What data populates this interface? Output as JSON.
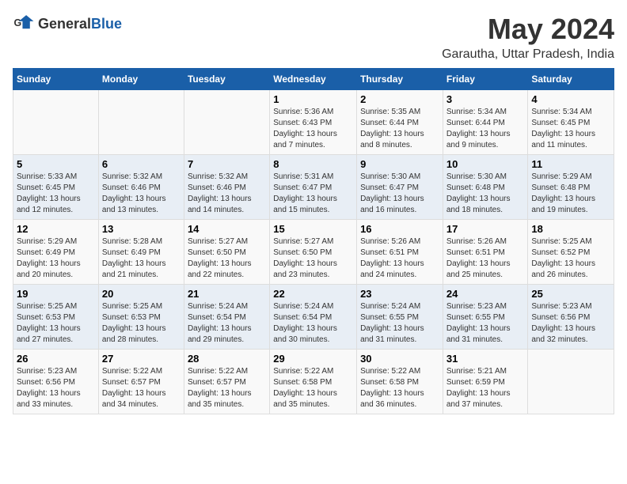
{
  "header": {
    "logo_general": "General",
    "logo_blue": "Blue",
    "title": "May 2024",
    "subtitle": "Garautha, Uttar Pradesh, India"
  },
  "columns": [
    "Sunday",
    "Monday",
    "Tuesday",
    "Wednesday",
    "Thursday",
    "Friday",
    "Saturday"
  ],
  "weeks": [
    {
      "days": [
        {
          "num": "",
          "info": ""
        },
        {
          "num": "",
          "info": ""
        },
        {
          "num": "",
          "info": ""
        },
        {
          "num": "1",
          "info": "Sunrise: 5:36 AM\nSunset: 6:43 PM\nDaylight: 13 hours\nand 7 minutes."
        },
        {
          "num": "2",
          "info": "Sunrise: 5:35 AM\nSunset: 6:44 PM\nDaylight: 13 hours\nand 8 minutes."
        },
        {
          "num": "3",
          "info": "Sunrise: 5:34 AM\nSunset: 6:44 PM\nDaylight: 13 hours\nand 9 minutes."
        },
        {
          "num": "4",
          "info": "Sunrise: 5:34 AM\nSunset: 6:45 PM\nDaylight: 13 hours\nand 11 minutes."
        }
      ]
    },
    {
      "days": [
        {
          "num": "5",
          "info": "Sunrise: 5:33 AM\nSunset: 6:45 PM\nDaylight: 13 hours\nand 12 minutes."
        },
        {
          "num": "6",
          "info": "Sunrise: 5:32 AM\nSunset: 6:46 PM\nDaylight: 13 hours\nand 13 minutes."
        },
        {
          "num": "7",
          "info": "Sunrise: 5:32 AM\nSunset: 6:46 PM\nDaylight: 13 hours\nand 14 minutes."
        },
        {
          "num": "8",
          "info": "Sunrise: 5:31 AM\nSunset: 6:47 PM\nDaylight: 13 hours\nand 15 minutes."
        },
        {
          "num": "9",
          "info": "Sunrise: 5:30 AM\nSunset: 6:47 PM\nDaylight: 13 hours\nand 16 minutes."
        },
        {
          "num": "10",
          "info": "Sunrise: 5:30 AM\nSunset: 6:48 PM\nDaylight: 13 hours\nand 18 minutes."
        },
        {
          "num": "11",
          "info": "Sunrise: 5:29 AM\nSunset: 6:48 PM\nDaylight: 13 hours\nand 19 minutes."
        }
      ]
    },
    {
      "days": [
        {
          "num": "12",
          "info": "Sunrise: 5:29 AM\nSunset: 6:49 PM\nDaylight: 13 hours\nand 20 minutes."
        },
        {
          "num": "13",
          "info": "Sunrise: 5:28 AM\nSunset: 6:49 PM\nDaylight: 13 hours\nand 21 minutes."
        },
        {
          "num": "14",
          "info": "Sunrise: 5:27 AM\nSunset: 6:50 PM\nDaylight: 13 hours\nand 22 minutes."
        },
        {
          "num": "15",
          "info": "Sunrise: 5:27 AM\nSunset: 6:50 PM\nDaylight: 13 hours\nand 23 minutes."
        },
        {
          "num": "16",
          "info": "Sunrise: 5:26 AM\nSunset: 6:51 PM\nDaylight: 13 hours\nand 24 minutes."
        },
        {
          "num": "17",
          "info": "Sunrise: 5:26 AM\nSunset: 6:51 PM\nDaylight: 13 hours\nand 25 minutes."
        },
        {
          "num": "18",
          "info": "Sunrise: 5:25 AM\nSunset: 6:52 PM\nDaylight: 13 hours\nand 26 minutes."
        }
      ]
    },
    {
      "days": [
        {
          "num": "19",
          "info": "Sunrise: 5:25 AM\nSunset: 6:53 PM\nDaylight: 13 hours\nand 27 minutes."
        },
        {
          "num": "20",
          "info": "Sunrise: 5:25 AM\nSunset: 6:53 PM\nDaylight: 13 hours\nand 28 minutes."
        },
        {
          "num": "21",
          "info": "Sunrise: 5:24 AM\nSunset: 6:54 PM\nDaylight: 13 hours\nand 29 minutes."
        },
        {
          "num": "22",
          "info": "Sunrise: 5:24 AM\nSunset: 6:54 PM\nDaylight: 13 hours\nand 30 minutes."
        },
        {
          "num": "23",
          "info": "Sunrise: 5:24 AM\nSunset: 6:55 PM\nDaylight: 13 hours\nand 31 minutes."
        },
        {
          "num": "24",
          "info": "Sunrise: 5:23 AM\nSunset: 6:55 PM\nDaylight: 13 hours\nand 31 minutes."
        },
        {
          "num": "25",
          "info": "Sunrise: 5:23 AM\nSunset: 6:56 PM\nDaylight: 13 hours\nand 32 minutes."
        }
      ]
    },
    {
      "days": [
        {
          "num": "26",
          "info": "Sunrise: 5:23 AM\nSunset: 6:56 PM\nDaylight: 13 hours\nand 33 minutes."
        },
        {
          "num": "27",
          "info": "Sunrise: 5:22 AM\nSunset: 6:57 PM\nDaylight: 13 hours\nand 34 minutes."
        },
        {
          "num": "28",
          "info": "Sunrise: 5:22 AM\nSunset: 6:57 PM\nDaylight: 13 hours\nand 35 minutes."
        },
        {
          "num": "29",
          "info": "Sunrise: 5:22 AM\nSunset: 6:58 PM\nDaylight: 13 hours\nand 35 minutes."
        },
        {
          "num": "30",
          "info": "Sunrise: 5:22 AM\nSunset: 6:58 PM\nDaylight: 13 hours\nand 36 minutes."
        },
        {
          "num": "31",
          "info": "Sunrise: 5:21 AM\nSunset: 6:59 PM\nDaylight: 13 hours\nand 37 minutes."
        },
        {
          "num": "",
          "info": ""
        }
      ]
    }
  ]
}
